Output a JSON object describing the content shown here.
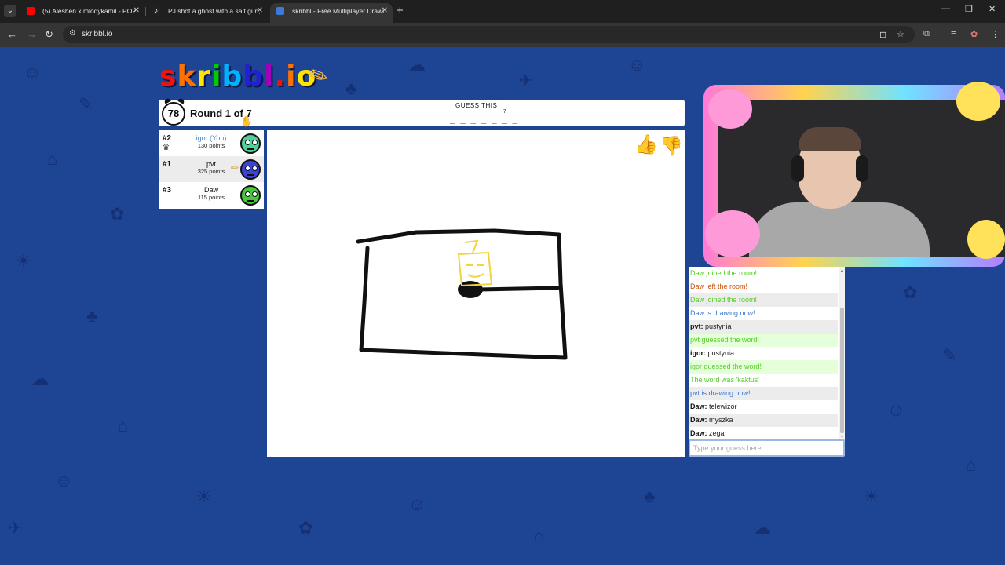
{
  "browser": {
    "tabs": [
      {
        "title": "(5) Aleshen x mlodykamil - PO2",
        "favicon_color": "#ff0000",
        "active": false
      },
      {
        "title": "PJ shot a ghost with a salt gun,",
        "favicon_color": "#ffffff",
        "active": false
      },
      {
        "title": "skribbl - Free Multiplayer Drawi",
        "favicon_color": "#3d7bd9",
        "active": true
      }
    ],
    "url": "skribbl.io"
  },
  "game": {
    "logo_letters": [
      "s",
      "k",
      "r",
      "i",
      "b",
      "b",
      "l",
      ".",
      "i",
      "o"
    ],
    "logo_colors": [
      "#ef130b",
      "#ff7100",
      "#ffe400",
      "#00cc00",
      "#00b2ff",
      "#231fd3",
      "#a300ba",
      "#ef130b",
      "#ff7100",
      "#ffe400"
    ],
    "timer": "78",
    "round": "Round 1 of 7",
    "guess_label": "GUESS THIS",
    "hint": "_ _ _ _ _ _ _",
    "hint_count": "7",
    "players": [
      {
        "rank": "#2",
        "name": "igor (You)",
        "points": "130 points",
        "you": true,
        "avatar_color": "#4fd19a"
      },
      {
        "rank": "#1",
        "name": "pvt",
        "points": "325 points",
        "you": false,
        "avatar_color": "#3b42d6"
      },
      {
        "rank": "#3",
        "name": "Daw",
        "points": "115 points",
        "you": false,
        "avatar_color": "#47c93b"
      }
    ]
  },
  "chat": {
    "messages": [
      {
        "type": "green",
        "text": "Daw joined the room!"
      },
      {
        "type": "red",
        "text": "Daw left the room!"
      },
      {
        "type": "green",
        "text": "Daw joined the room!"
      },
      {
        "type": "blue",
        "text": "Daw is drawing now!"
      },
      {
        "type": "user",
        "name": "pvt:",
        "text": "pustynia"
      },
      {
        "type": "green",
        "text": "pvt guessed the word!"
      },
      {
        "type": "user",
        "name": "igor:",
        "text": "pustynia"
      },
      {
        "type": "green",
        "text": "igor guessed the word!"
      },
      {
        "type": "green",
        "text": "The word was 'kaktus'"
      },
      {
        "type": "blue",
        "text": "pvt is drawing now!"
      },
      {
        "type": "user",
        "name": "Daw:",
        "text": "telewizor"
      },
      {
        "type": "user",
        "name": "Daw:",
        "text": "myszka"
      },
      {
        "type": "user",
        "name": "Daw:",
        "text": "zegar"
      }
    ],
    "placeholder": "Type your guess here..."
  }
}
